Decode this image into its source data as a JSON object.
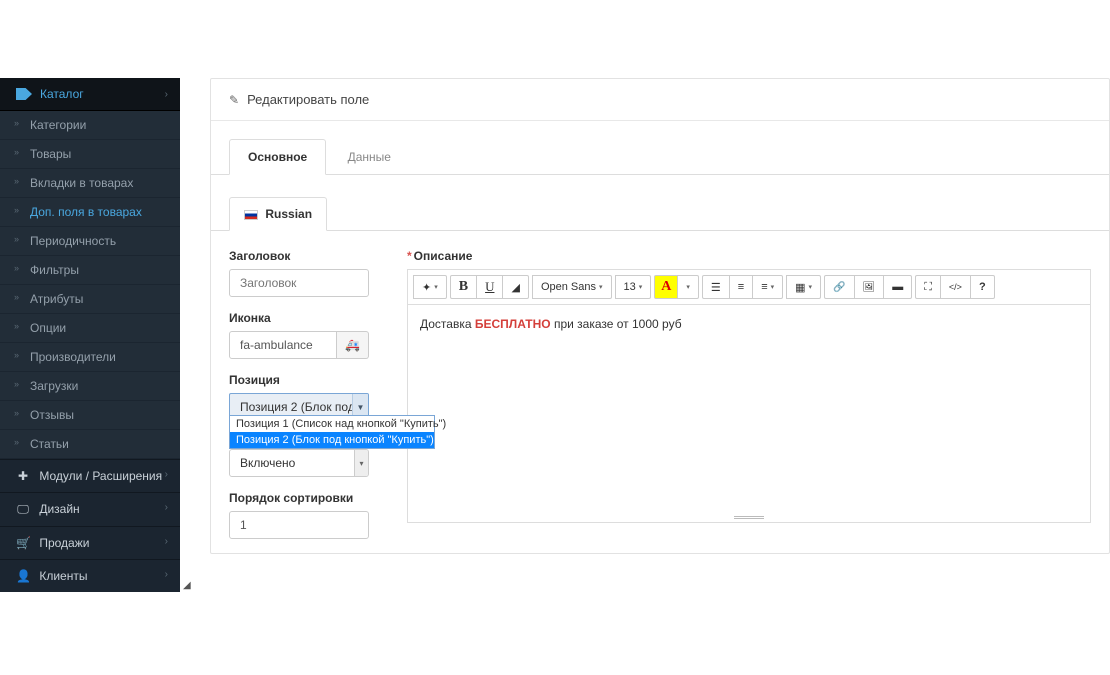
{
  "sidebar": {
    "catalog_label": "Каталог",
    "items": [
      {
        "label": "Категории"
      },
      {
        "label": "Товары"
      },
      {
        "label": "Вкладки в товарах"
      },
      {
        "label": "Доп. поля в товарах"
      },
      {
        "label": "Периодичность"
      },
      {
        "label": "Фильтры"
      },
      {
        "label": "Атрибуты"
      },
      {
        "label": "Опции"
      },
      {
        "label": "Производители"
      },
      {
        "label": "Загрузки"
      },
      {
        "label": "Отзывы"
      },
      {
        "label": "Статьи"
      }
    ],
    "sections": [
      {
        "icon": "🧩",
        "label": "Модули / Расширения"
      },
      {
        "icon": "🖥",
        "label": "Дизайн"
      },
      {
        "icon": "🛒",
        "label": "Продажи"
      },
      {
        "icon": "👤",
        "label": "Клиенты"
      }
    ]
  },
  "panel": {
    "title": "Редактировать поле",
    "tabs": {
      "main": "Основное",
      "data": "Данные"
    },
    "lang": "Russian"
  },
  "form": {
    "title_label": "Заголовок",
    "title_placeholder": "Заголовок",
    "icon_label": "Иконка",
    "icon_value": "fa-ambulance",
    "position_label": "Позиция",
    "position_value": "Позиция 2 (Блок под",
    "position_options": [
      "Позиция 1 (Список над кнопкой \"Купить\")",
      "Позиция 2 (Блок под кнопкой \"Купить\")"
    ],
    "status_value": "Включено",
    "sort_label": "Порядок сортировки",
    "sort_value": "1",
    "desc_label": "Описание"
  },
  "toolbar": {
    "font": "Open Sans",
    "size": "13"
  },
  "editor": {
    "text_before": "Доставка ",
    "text_free": "БЕСПЛАТНО",
    "text_after": " при заказе от 1000 руб"
  }
}
